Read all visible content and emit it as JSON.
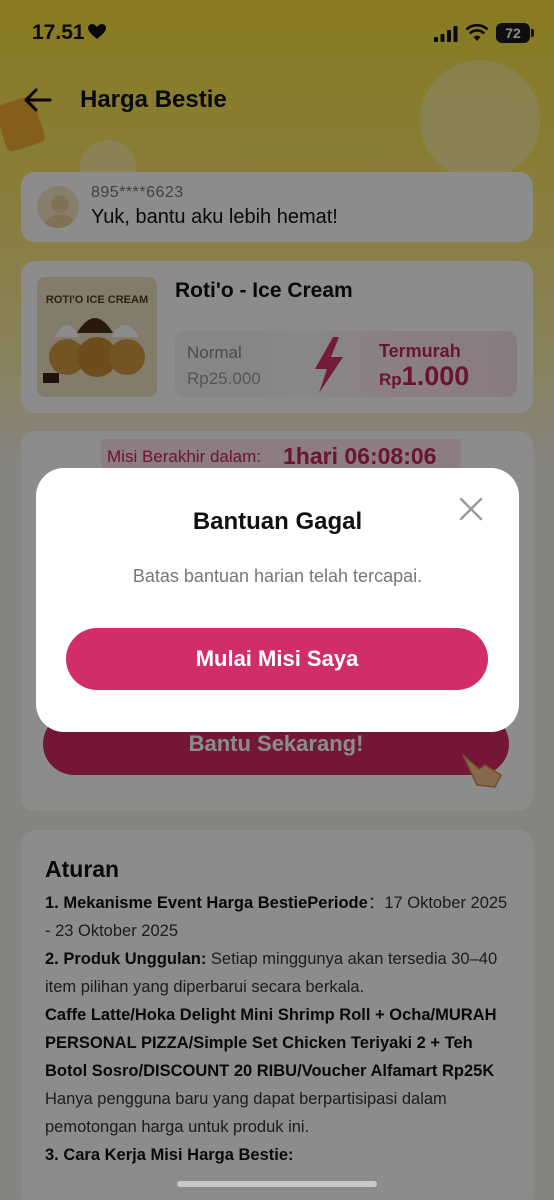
{
  "status_bar": {
    "time": "17.51",
    "battery": "72"
  },
  "header": {
    "title": "Harga Bestie"
  },
  "inviter": {
    "phone": "895****6623",
    "message": "Yuk, bantu aku lebih hemat!"
  },
  "product": {
    "name": "Roti'o - Ice Cream",
    "image_text": "ROTI'O ICE CREAM",
    "normal_label": "Normal",
    "normal_price": "Rp25.000",
    "cheapest_label": "Termurah",
    "cheapest_currency": "Rp",
    "cheapest_amount": "1.000"
  },
  "mission": {
    "timer_label": "Misi Berakhir dalam:",
    "timer_value": "1hari 06:08:06",
    "help_button": "Bantu Sekarang!"
  },
  "rules": {
    "title": "Aturan",
    "item1_bold": "1. Mekanisme Event Harga BestiePeriode",
    "item1_text": "：17 Oktober 2025 - 23 Oktober 2025",
    "item2_bold": "2. Produk Unggulan:",
    "item2_text": " Setiap minggunya akan tersedia 30–40 item pilihan yang diperbarui secara berkala.",
    "item2_products": "Caffe Latte/Hoka Delight Mini Shrimp Roll + Ocha/MURAH PERSONAL PIZZA/Simple Set Chicken Teriyaki 2 + Teh Botol Sosro/DISCOUNT 20 RIBU/Voucher Alfamart Rp25K",
    "item2_tail": " Hanya pengguna baru yang dapat berpartisipasi dalam pemotongan harga untuk produk ini.",
    "item3_bold": "3. Cara Kerja Misi Harga Bestie:"
  },
  "modal": {
    "title": "Bantuan Gagal",
    "message": "Batas bantuan harian telah tercapai.",
    "button": "Mulai Misi Saya"
  },
  "colors": {
    "accent": "#d12d68",
    "brand_yellow": "#f7df3c"
  }
}
